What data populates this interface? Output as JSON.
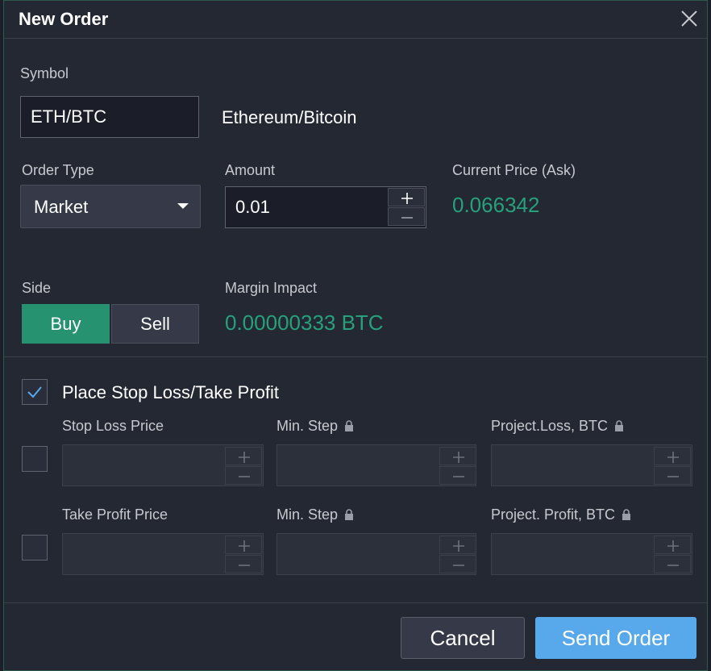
{
  "dialog": {
    "title": "New Order"
  },
  "symbol": {
    "label": "Symbol",
    "value": "ETH/BTC",
    "description": "Ethereum/Bitcoin"
  },
  "order_type": {
    "label": "Order Type",
    "selected": "Market"
  },
  "amount": {
    "label": "Amount",
    "value": "0.01"
  },
  "current_price": {
    "label": "Current Price (Ask)",
    "value": "0.066342"
  },
  "side": {
    "label": "Side",
    "buy": "Buy",
    "sell": "Sell",
    "selected": "Buy"
  },
  "margin_impact": {
    "label": "Margin Impact",
    "value": "0.00000333 BTC"
  },
  "sl_tp": {
    "toggle_label": "Place Stop Loss/Take Profit",
    "checked": true,
    "stop_loss": {
      "price_label": "Stop Loss Price",
      "step_label": "Min. Step",
      "projected_label": "Project.Loss, BTC",
      "checked": false
    },
    "take_profit": {
      "price_label": "Take Profit Price",
      "step_label": "Min. Step",
      "projected_label": "Project. Profit, BTC",
      "checked": false
    }
  },
  "actions": {
    "cancel": "Cancel",
    "send": "Send Order"
  },
  "colors": {
    "accent_green": "#26a17b",
    "buy_green": "#26926f",
    "send_blue": "#57a9ec",
    "border_teal": "#2d5a4c"
  },
  "icons": {
    "close": "close-icon",
    "caret": "chevron-down-icon",
    "plus": "plus-icon",
    "minus": "minus-icon",
    "check": "check-icon",
    "lock": "lock-icon"
  }
}
